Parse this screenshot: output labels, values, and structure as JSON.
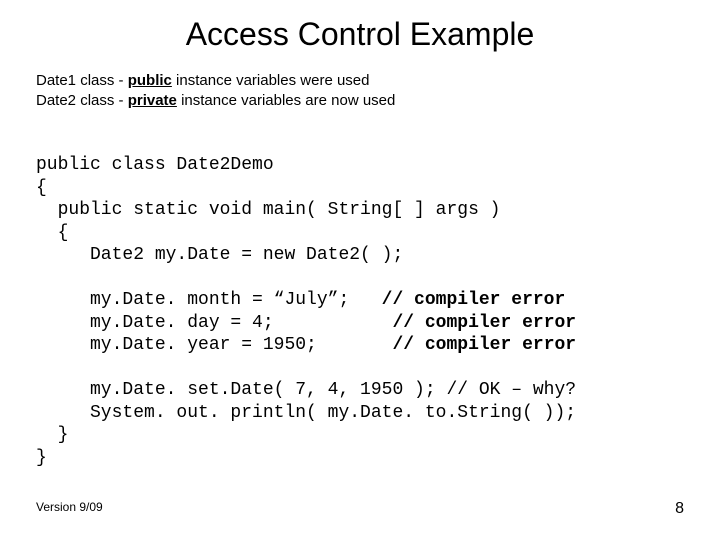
{
  "title": "Access Control Example",
  "subtitle": {
    "line1_prefix": "Date1 class - ",
    "line1_bold": "public",
    "line1_suffix": " instance variables were used",
    "line2_prefix": "Date2 class - ",
    "line2_bold": "private",
    "line2_suffix": " instance variables are now used"
  },
  "code": {
    "l1": "public class Date2Demo",
    "l2": "{",
    "l3": "  public static void main( String[ ] args )",
    "l4": "  {",
    "l5": "     Date2 my.Date = new Date2( );",
    "blank1": "",
    "l6a": "     my.Date. month = “July”;   ",
    "l6b": "// compiler error",
    "l7a": "     my.Date. day = 4;           ",
    "l7b": "// compiler error",
    "l8a": "     my.Date. year = 1950;       ",
    "l8b": "// compiler error",
    "blank2": "",
    "l9": "     my.Date. set.Date( 7, 4, 1950 ); // OK – why?",
    "l10": "     System. out. println( my.Date. to.String( ));",
    "l11": "  }",
    "l12": "}"
  },
  "footer": {
    "version": "Version 9/09",
    "page": "8"
  }
}
